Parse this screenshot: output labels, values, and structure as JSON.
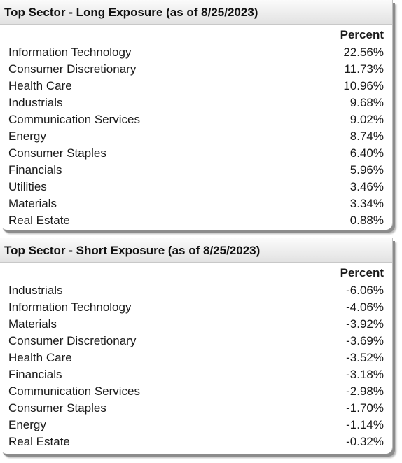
{
  "long": {
    "title": "Top Sector - Long Exposure (as of 8/25/2023)",
    "column_header": "Percent",
    "rows": [
      {
        "sector": "Information Technology",
        "percent": "22.56%"
      },
      {
        "sector": "Consumer Discretionary",
        "percent": "11.73%"
      },
      {
        "sector": "Health Care",
        "percent": "10.96%"
      },
      {
        "sector": "Industrials",
        "percent": "9.68%"
      },
      {
        "sector": "Communication Services",
        "percent": "9.02%"
      },
      {
        "sector": "Energy",
        "percent": "8.74%"
      },
      {
        "sector": "Consumer Staples",
        "percent": "6.40%"
      },
      {
        "sector": "Financials",
        "percent": "5.96%"
      },
      {
        "sector": "Utilities",
        "percent": "3.46%"
      },
      {
        "sector": "Materials",
        "percent": "3.34%"
      },
      {
        "sector": "Real Estate",
        "percent": "0.88%"
      }
    ]
  },
  "short": {
    "title": "Top Sector - Short Exposure (as of 8/25/2023)",
    "column_header": "Percent",
    "rows": [
      {
        "sector": "Industrials",
        "percent": "-6.06%"
      },
      {
        "sector": "Information Technology",
        "percent": "-4.06%"
      },
      {
        "sector": "Materials",
        "percent": "-3.92%"
      },
      {
        "sector": "Consumer Discretionary",
        "percent": "-3.69%"
      },
      {
        "sector": "Health Care",
        "percent": "-3.52%"
      },
      {
        "sector": "Financials",
        "percent": "-3.18%"
      },
      {
        "sector": "Communication Services",
        "percent": "-2.98%"
      },
      {
        "sector": "Consumer Staples",
        "percent": "-1.70%"
      },
      {
        "sector": "Energy",
        "percent": "-1.14%"
      },
      {
        "sector": "Real Estate",
        "percent": "-0.32%"
      }
    ]
  }
}
